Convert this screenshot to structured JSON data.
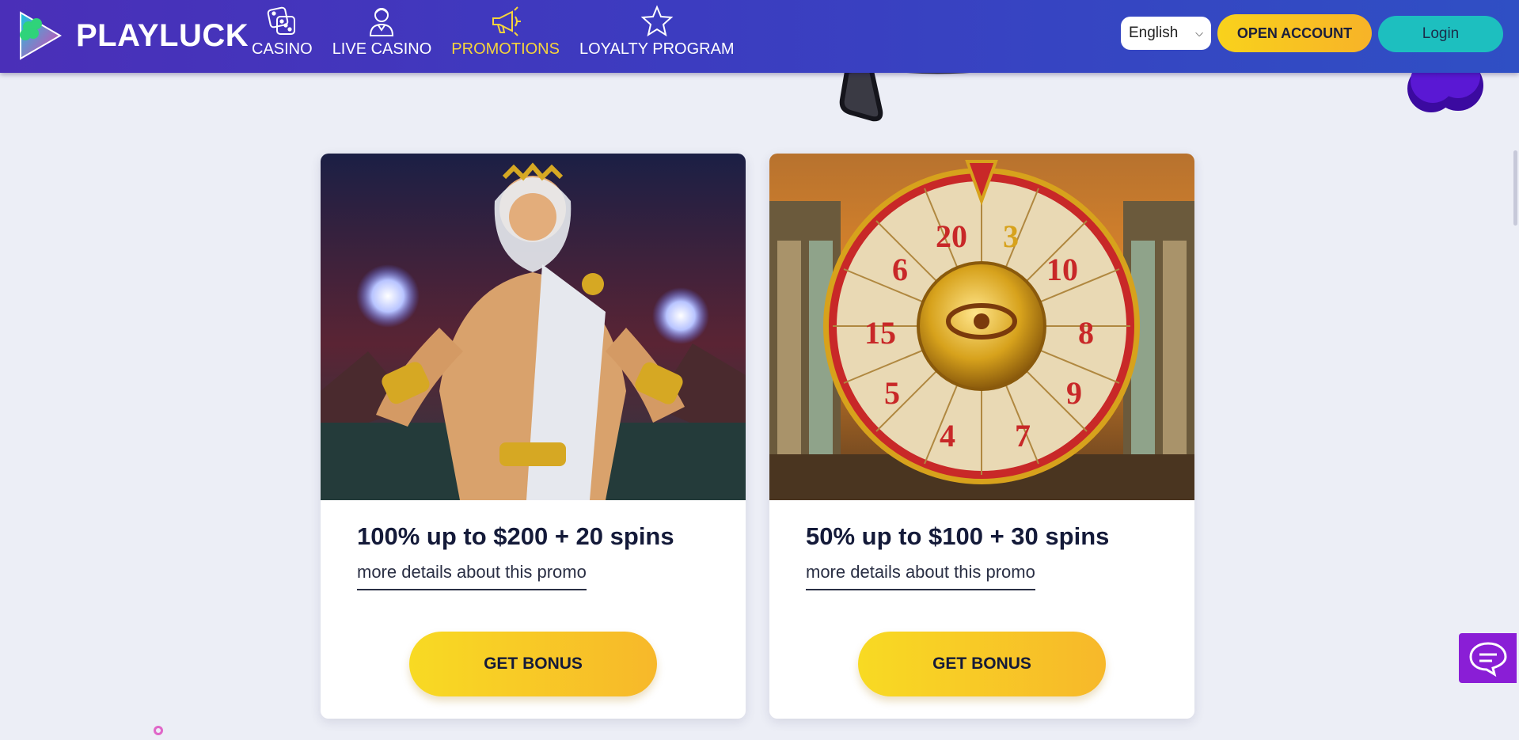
{
  "header": {
    "brand": "PLAYLUCK",
    "nav": [
      {
        "label": "CASINO",
        "icon": "dice-icon",
        "active": false
      },
      {
        "label": "LIVE CASINO",
        "icon": "dealer-icon",
        "active": false
      },
      {
        "label": "PROMOTIONS",
        "icon": "megaphone-icon",
        "active": true
      },
      {
        "label": "LOYALTY PROGRAM",
        "icon": "star-icon",
        "active": false
      }
    ],
    "language": "English",
    "open_account": "OPEN ACCOUNT",
    "login": "Login"
  },
  "promos": [
    {
      "title": "100% up to $200 + 20 spins",
      "link": "more details about this promo",
      "button": "GET BONUS",
      "image": "zeus-character-image"
    },
    {
      "title": "50% up to $100 + 30 spins",
      "link": "more details about this promo",
      "button": "GET BONUS",
      "image": "egyptian-bonus-wheel-image"
    }
  ],
  "wheel_numbers": [
    "3",
    "10",
    "8",
    "9",
    "7",
    "4",
    "5",
    "15",
    "6",
    "20"
  ],
  "colors": {
    "header_start": "#4a2fb8",
    "header_end": "#2f4fc4",
    "accent_yellow": "#f8d21c",
    "login_teal": "#1dbfbf",
    "active_nav": "#f6d43b",
    "chat_purple": "#8a1ed6"
  }
}
